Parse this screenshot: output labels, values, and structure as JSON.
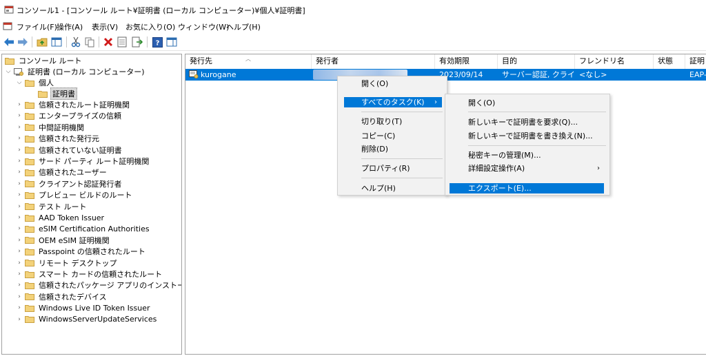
{
  "window": {
    "title": "コンソール1 - [コンソール ルート¥証明書 (ローカル コンピューター)¥個人¥証明書]"
  },
  "menubar": {
    "items": [
      "ファイル(F)",
      "操作(A)",
      "表示(V)",
      "お気に入り(O)",
      "ウィンドウ(W)",
      "ヘルプ(H)"
    ]
  },
  "toolbar": {
    "buttons": [
      "back-arrow-icon",
      "forward-arrow-icon",
      "up-folder-icon",
      "show-hide-tree-icon",
      "cut-icon",
      "copy-icon",
      "delete-icon",
      "properties-icon",
      "export-list-icon",
      "help-icon",
      "show-hide-action-pane-icon"
    ]
  },
  "tree": {
    "root": "コンソール ルート",
    "cert_store": "証明書 (ローカル コンピューター)",
    "personal": "個人",
    "certificates": "証明書",
    "folders": [
      "信頼されたルート証明機関",
      "エンタープライズの信頼",
      "中間証明機関",
      "信頼された発行元",
      "信頼されていない証明書",
      "サード パーティ ルート証明機関",
      "信頼されたユーザー",
      "クライアント認証発行者",
      "プレビュー ビルドのルート",
      "テスト ルート",
      "AAD Token Issuer",
      "eSIM Certification Authorities",
      "OEM eSIM 証明機関",
      "Passpoint の信頼されたルート",
      "リモート デスクトップ",
      "スマート カードの信頼されたルート",
      "信頼されたパッケージ アプリのインストール機関",
      "信頼されたデバイス",
      "Windows Live ID Token Issuer",
      "WindowsServerUpdateServices"
    ]
  },
  "list": {
    "columns": [
      "発行先",
      "発行者",
      "有効期限",
      "目的",
      "フレンドリ名",
      "状態",
      "証明"
    ],
    "rows": [
      {
        "issued_to": "kurogane",
        "expiration": "2023/09/14",
        "purpose": "サーバー認証, クライア...",
        "friendly_name": "<なし>",
        "status": "",
        "template": "EAP-"
      }
    ]
  },
  "context_menu": {
    "items": {
      "open": "開く(O)",
      "all_tasks": "すべてのタスク(K)",
      "cut": "切り取り(T)",
      "copy": "コピー(C)",
      "delete": "削除(D)",
      "properties": "プロパティ(R)",
      "help": "ヘルプ(H)"
    }
  },
  "submenu": {
    "items": {
      "open": "開く(O)",
      "request_new_key": "新しいキーで証明書を要求(Q)...",
      "renew_new_key": "新しいキーで証明書を書き換え(N)...",
      "manage_private_keys": "秘密キーの管理(M)...",
      "advanced": "詳細設定操作(A)",
      "export": "エクスポート(E)..."
    }
  },
  "colors": {
    "selection": "#0078d7",
    "menu_bg": "#f2f2f2",
    "folder": "#e8c15a"
  }
}
